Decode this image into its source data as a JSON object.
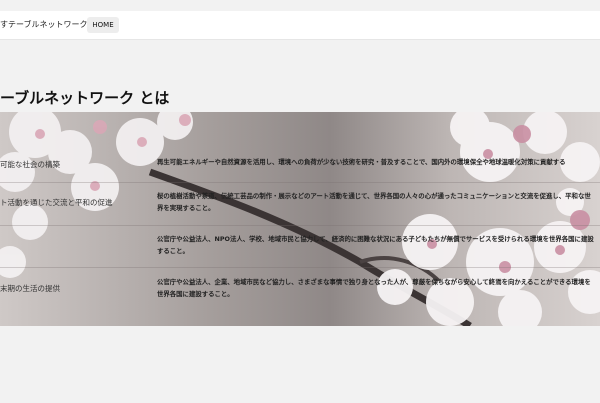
{
  "header": {
    "brand": "すテーブルネットワーク",
    "nav_home": "HOME"
  },
  "page": {
    "title": "ーブルネットワーク とは"
  },
  "missions": [
    {
      "title": "可能な社会の構築",
      "description": "再生可能エネルギーや自然資源を活用し、環境への負荷が少ない技術を研究・普及することで、国内外の環境保全や地球温暖化対策に貢献する"
    },
    {
      "title": "ト活動を通じた交流と平和の促進",
      "description": "桜の植樹活動や茶道、伝統工芸品の制作・展示などのアート活動を通じて、世界各国の人々の心が通ったコミュニケーションと交流を促進し、平和な世界を実現すること。"
    },
    {
      "title": "",
      "description": "公官庁や公益法人、NPO法人、学校、地域市民と協力して、経済的に困難な状況にある子どもたちが無償でサービスを受けられる環境を世界各国に建設すること。"
    },
    {
      "title": "末期の生活の提供",
      "description": "公官庁や公益法人、企業、地域市民など協力し、さまざまな事情で独り身となった人が、尊厳を保ちながら安心して終焉を向かえることができる環境を世界各国に建設すること。"
    }
  ]
}
